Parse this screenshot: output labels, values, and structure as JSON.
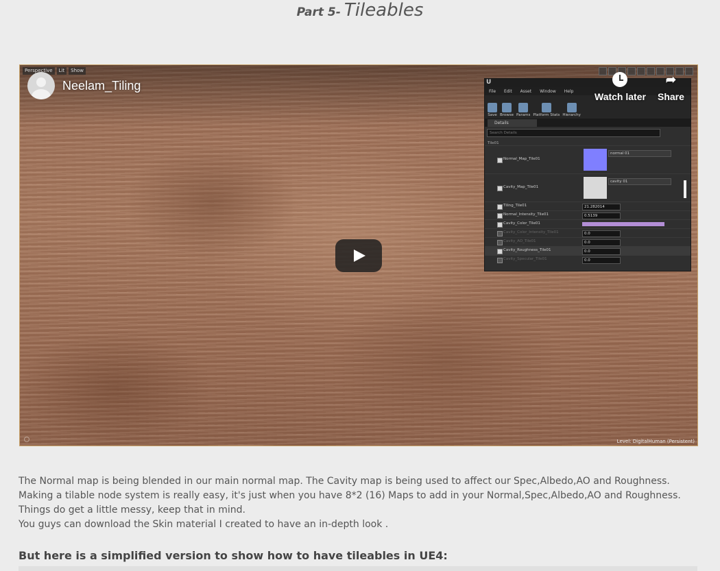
{
  "heading": {
    "part": "Part 5-",
    "title": "Tileables"
  },
  "video": {
    "channel_title": "Neelam_Tiling",
    "watch_later": "Watch later",
    "share": "Share",
    "level_label": "Level:  DigitalHuman (Persistent)"
  },
  "ue_editor": {
    "viewport_toolbar": [
      "Perspective",
      "Lit",
      "Show"
    ],
    "menu": [
      "File",
      "Edit",
      "Asset",
      "Window",
      "Help"
    ],
    "toolbar": [
      "Save",
      "Browse",
      "Params",
      "Platform Stats",
      "Hierarchy"
    ],
    "tab": "Details",
    "search_placeholder": "Search Details",
    "category": "Tile01",
    "rows": [
      {
        "label": "Normal_Map_Tile01",
        "type": "texture",
        "dropdown": "normal 01",
        "swatch": "#7f7fff"
      },
      {
        "label": "Cavity_Map_Tile01",
        "type": "texture",
        "dropdown": "cavity 01",
        "swatch": "#d9d9d9"
      },
      {
        "label": "Tiling_Tile01",
        "type": "value",
        "value": "21.282014"
      },
      {
        "label": "Normal_Intensity_Tile01",
        "type": "value",
        "value": "0.5139"
      },
      {
        "label": "Cavity_Color_Tile01",
        "type": "color"
      },
      {
        "label": "Cavity_Color_Intensity_Tile01",
        "type": "value",
        "value": "0.0",
        "dim": true
      },
      {
        "label": "Cavity_AO_Tile01",
        "type": "value",
        "value": "0.0",
        "dim": true
      },
      {
        "label": "Cavity_Roughness_Tile01",
        "type": "value",
        "value": "0.0"
      },
      {
        "label": "Cavity_Specular_Tile01",
        "type": "value",
        "value": "0.0",
        "dim": true
      }
    ]
  },
  "body": {
    "paragraph1": "The Normal map is being blended in our main normal map. The Cavity map is being used to affect our Spec,Albedo,AO and Roughness. Making a tilable node system is really easy, it's just when you have 8*2 (16) Maps to add in your Normal,Spec,Albedo,AO and Roughness. Things do get a little messy, keep that in mind.",
    "paragraph2": "You guys can download the Skin material I created to have an in-depth look ."
  },
  "subheading": "But here is a simplified version to show how to have tileables in UE4:",
  "colors": {
    "accent_border": "#c8a36a",
    "skin": "#a87a60",
    "ue_panel": "#2f2f2f"
  }
}
